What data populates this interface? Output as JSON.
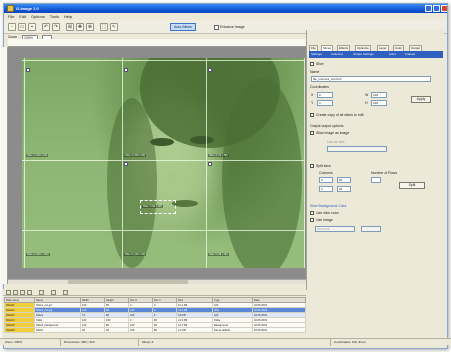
{
  "window": {
    "title": "G-Image 2.0"
  },
  "menu": [
    "File",
    "Edit",
    "Options",
    "Tools",
    "Help"
  ],
  "toolbar": {
    "toggle_label": "Auto-Slices",
    "check_label": "Enhance Image",
    "button_icons": [
      "new-icon",
      "open-icon",
      "save-icon",
      "undo-icon",
      "redo-icon",
      "slice-icon",
      "move-icon",
      "zoom-icon",
      "select-icon",
      "pointer-icon"
    ]
  },
  "zoombar": {
    "label": "Zoom",
    "value": "100%"
  },
  "canvas": {
    "slice_labels": [
      "Slice 1 (120 x 80)",
      "Slice 2 (120 x 80)",
      "Slice 3 (72 x 80)",
      "Slice 4 (120 x 160)",
      "Slice 5 (120 x 80)",
      "Slice 6 (48 x 40)"
    ],
    "selection_label": "Slice 7 (96 x 28)"
  },
  "panel": {
    "tabs": [
      "File",
      "Slices",
      "Effects",
      "Optimize",
      "Layer",
      "Color",
      "Output"
    ],
    "strip_items": [
      "Settings",
      "Columns",
      "Output Settings",
      "Anim",
      "Frames"
    ],
    "title_check": "Slice",
    "name_label": "Name",
    "name_value": "file_picture1_cut.html",
    "coordinates_label": "Coordinates",
    "x_label": "X",
    "y_label": "Y",
    "w_label": "W",
    "h_label": "H",
    "x_value": "0",
    "y_value": "0",
    "w_value": "128",
    "h_value": "128",
    "apply_label": "Apply",
    "check_copy": "Create copy of all slices to edit",
    "output_label": "Output output options",
    "check_slice_image": "Slice image as image",
    "text_placeholder": "Use as text",
    "check_split": "Split slice",
    "split_columns": "Columns",
    "split_rows": "Number of Rows",
    "split_cols_value": "2",
    "split_rows_value": "2",
    "split_w_value": "64",
    "split_h_value": "64",
    "split_button": "Split",
    "bg_section": "Slice Background Color",
    "check_bg1": "Use slice color",
    "check_bg2": "Use image",
    "bg_select": "#FFFFFF"
  },
  "table": {
    "headers": [
      "Slice name",
      "Name",
      "Width",
      "Height",
      "Pos X",
      "Pos Y",
      "Size",
      "Type",
      "Date"
    ],
    "rows": [
      {
        "cells": [
          "Slice01",
          "Slice1_cut.gif",
          "120",
          "80",
          "0",
          "0",
          "12.1 KB",
          "GIF",
          "02.05.2003"
        ],
        "style": "normal"
      },
      {
        "cells": [
          "Slice02",
          "Slice2_cut.jpg",
          "120",
          "80",
          "120",
          "0",
          "15.4 KB",
          "JPG",
          "02.05.2003"
        ],
        "style": "hl"
      },
      {
        "cells": [
          "Slice03",
          "Slice3",
          "72",
          "80",
          "240",
          "0",
          "9.8 KB",
          "GIF",
          "02.05.2003"
        ],
        "style": "sub"
      },
      {
        "cells": [
          "Slice04",
          "Table",
          "120",
          "160",
          "0",
          "80",
          "21.3 KB",
          "Table",
          "02.05.2003"
        ],
        "style": "normal"
      },
      {
        "cells": [
          "Slice05",
          "Slice5_background",
          "120",
          "80",
          "120",
          "80",
          "14.7 KB",
          "Background",
          "02.05.2003"
        ],
        "style": "normal"
      },
      {
        "cells": [
          "Slice06",
          "Slice6",
          "48",
          "40",
          "240",
          "80",
          "4.2 KB",
          "Set as default",
          "02.05.2003"
        ],
        "style": "normal"
      }
    ]
  },
  "status": [
    "Zoom: 100%",
    "Dimensions: 480 x 320",
    "Slices: 6",
    "Coordinates: 120, 94 px"
  ]
}
